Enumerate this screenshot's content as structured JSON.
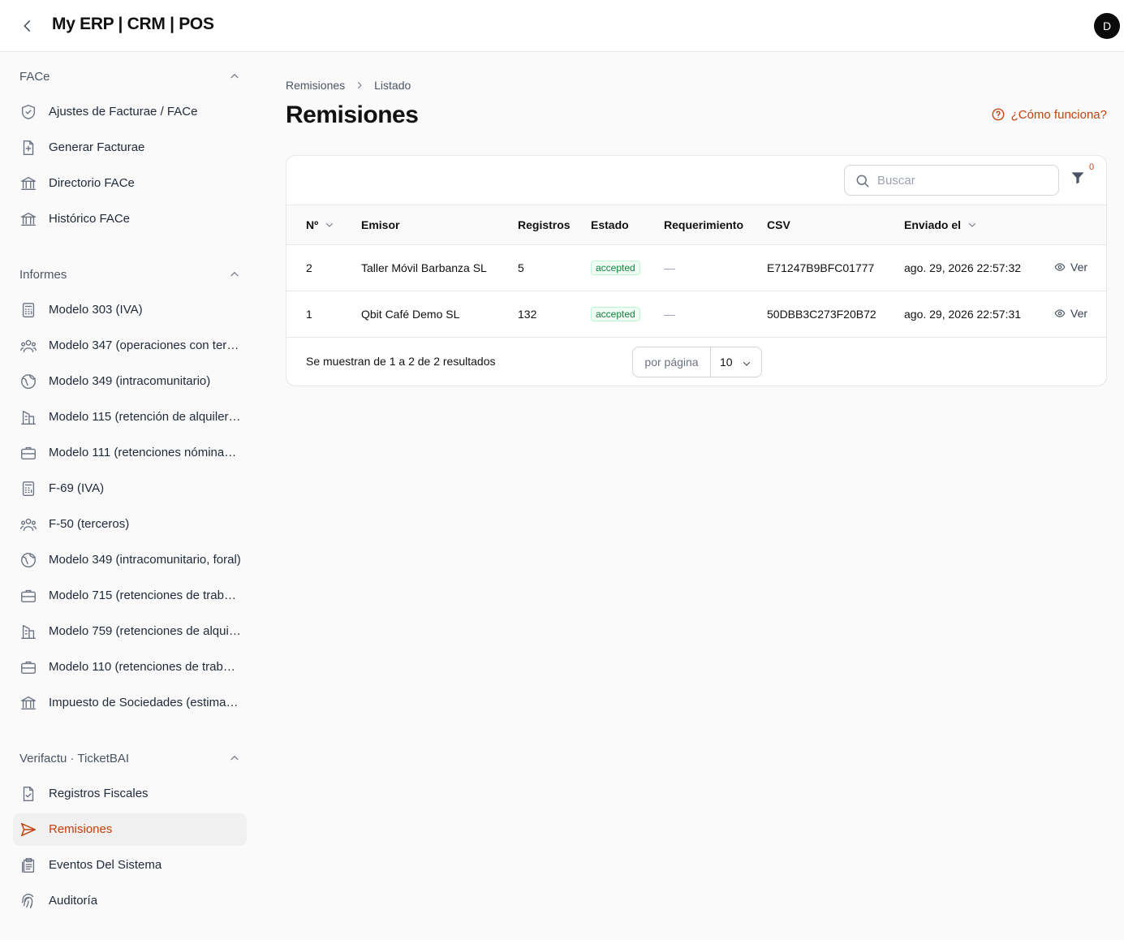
{
  "app": {
    "title": "My ERP | CRM | POS",
    "avatar_initial": "D"
  },
  "sidebar": {
    "groups": [
      {
        "title": "FACe",
        "items": [
          {
            "label": "Ajustes de Facturae / FACe",
            "icon": "shield-check-icon"
          },
          {
            "label": "Generar Facturae",
            "icon": "document-plus-icon"
          },
          {
            "label": "Directorio FACe",
            "icon": "building-library-icon"
          },
          {
            "label": "Histórico FACe",
            "icon": "building-library-icon"
          }
        ]
      },
      {
        "title": "Informes",
        "items": [
          {
            "label": "Modelo 303 (IVA)",
            "icon": "calculator-icon"
          },
          {
            "label": "Modelo 347 (operaciones con terceros)",
            "icon": "user-group-icon"
          },
          {
            "label": "Modelo 349 (intracomunitario)",
            "icon": "globe-icon"
          },
          {
            "label": "Modelo 115 (retención de alquileres)",
            "icon": "building-office-icon"
          },
          {
            "label": "Modelo 111 (retenciones nóminas y profesionales)",
            "icon": "briefcase-icon"
          },
          {
            "label": "F-69 (IVA)",
            "icon": "calculator-icon"
          },
          {
            "label": "F-50 (terceros)",
            "icon": "user-group-icon"
          },
          {
            "label": "Modelo 349 (intracomunitario, foral)",
            "icon": "globe-icon"
          },
          {
            "label": "Modelo 715 (retenciones de trabajo)",
            "icon": "briefcase-icon"
          },
          {
            "label": "Modelo 759 (retenciones de alquileres)",
            "icon": "building-office-icon"
          },
          {
            "label": "Modelo 110 (retenciones de trabajo)",
            "icon": "briefcase-icon"
          },
          {
            "label": "Impuesto de Sociedades (estimación)",
            "icon": "building-library-icon"
          }
        ]
      },
      {
        "title": "Verifactu · TicketBAI",
        "items": [
          {
            "label": "Registros Fiscales",
            "icon": "document-check-icon"
          },
          {
            "label": "Remisiones",
            "icon": "paper-airplane-icon",
            "active": true
          },
          {
            "label": "Eventos Del Sistema",
            "icon": "clipboard-document-icon"
          },
          {
            "label": "Auditoría",
            "icon": "fingerprint-icon"
          }
        ]
      }
    ]
  },
  "breadcrumb": {
    "parent": "Remisiones",
    "current": "Listado"
  },
  "page": {
    "title": "Remisiones",
    "help_link": "¿Cómo funciona?"
  },
  "toolbar": {
    "search_placeholder": "Buscar",
    "filter_count": "0"
  },
  "table": {
    "columns": [
      "Nº",
      "Emisor",
      "Registros",
      "Estado",
      "Requerimiento",
      "CSV",
      "Enviado el"
    ],
    "rows": [
      {
        "num": "2",
        "emisor": "Taller Móvil Barbanza SL",
        "registros": "5",
        "estado": "accepted",
        "requerimiento": "—",
        "csv": "E71247B9BFC01777",
        "enviado": "ago. 29, 2026 22:57:32",
        "action": "Ver"
      },
      {
        "num": "1",
        "emisor": "Qbit Café Demo SL",
        "registros": "132",
        "estado": "accepted",
        "requerimiento": "—",
        "csv": "50DBB3C273F20B72",
        "enviado": "ago. 29, 2026 22:57:31",
        "action": "Ver"
      }
    ]
  },
  "pagination": {
    "summary": "Se muestran de 1 a 2 de 2 resultados",
    "per_page_label": "por página",
    "per_page_value": "10"
  },
  "colors": {
    "accent": "#c2410c",
    "success": "#15803d"
  }
}
